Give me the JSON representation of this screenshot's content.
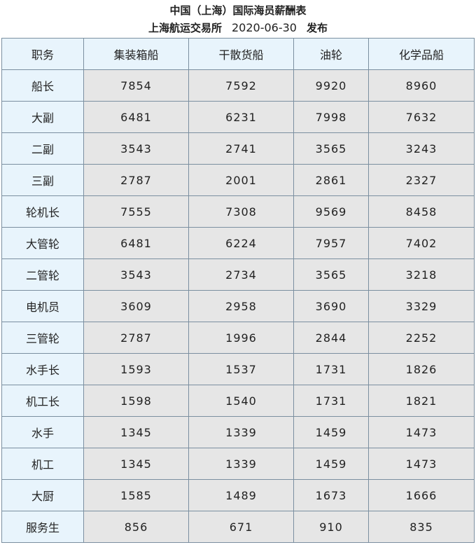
{
  "title": "中国（上海）国际海员薪酬表",
  "subtitle": {
    "publisher": "上海航运交易所",
    "date": "2020-06-30",
    "action": "发布"
  },
  "table": {
    "headers": [
      "职务",
      "集装箱船",
      "干散货船",
      "油轮",
      "化学品船"
    ],
    "rows": [
      {
        "rank": "船长",
        "values": [
          "7854",
          "7592",
          "9920",
          "8960"
        ]
      },
      {
        "rank": "大副",
        "values": [
          "6481",
          "6231",
          "7998",
          "7632"
        ]
      },
      {
        "rank": "二副",
        "values": [
          "3543",
          "2741",
          "3565",
          "3243"
        ]
      },
      {
        "rank": "三副",
        "values": [
          "2787",
          "2001",
          "2861",
          "2327"
        ]
      },
      {
        "rank": "轮机长",
        "values": [
          "7555",
          "7308",
          "9569",
          "8458"
        ]
      },
      {
        "rank": "大管轮",
        "values": [
          "6481",
          "6224",
          "7957",
          "7402"
        ]
      },
      {
        "rank": "二管轮",
        "values": [
          "3543",
          "2734",
          "3565",
          "3218"
        ]
      },
      {
        "rank": "电机员",
        "values": [
          "3609",
          "2958",
          "3690",
          "3329"
        ]
      },
      {
        "rank": "三管轮",
        "values": [
          "2787",
          "1996",
          "2844",
          "2252"
        ]
      },
      {
        "rank": "水手长",
        "values": [
          "1593",
          "1537",
          "1731",
          "1826"
        ]
      },
      {
        "rank": "机工长",
        "values": [
          "1598",
          "1540",
          "1731",
          "1821"
        ]
      },
      {
        "rank": "水手",
        "values": [
          "1345",
          "1339",
          "1459",
          "1473"
        ]
      },
      {
        "rank": "机工",
        "values": [
          "1345",
          "1339",
          "1459",
          "1473"
        ]
      },
      {
        "rank": "大厨",
        "values": [
          "1585",
          "1489",
          "1673",
          "1666"
        ]
      },
      {
        "rank": "服务生",
        "values": [
          "856",
          "671",
          "910",
          "835"
        ]
      }
    ]
  },
  "colors": {
    "header_bg": "#e8f4fc",
    "value_bg": "#e6e6e6",
    "border": "#7b8fa0"
  }
}
